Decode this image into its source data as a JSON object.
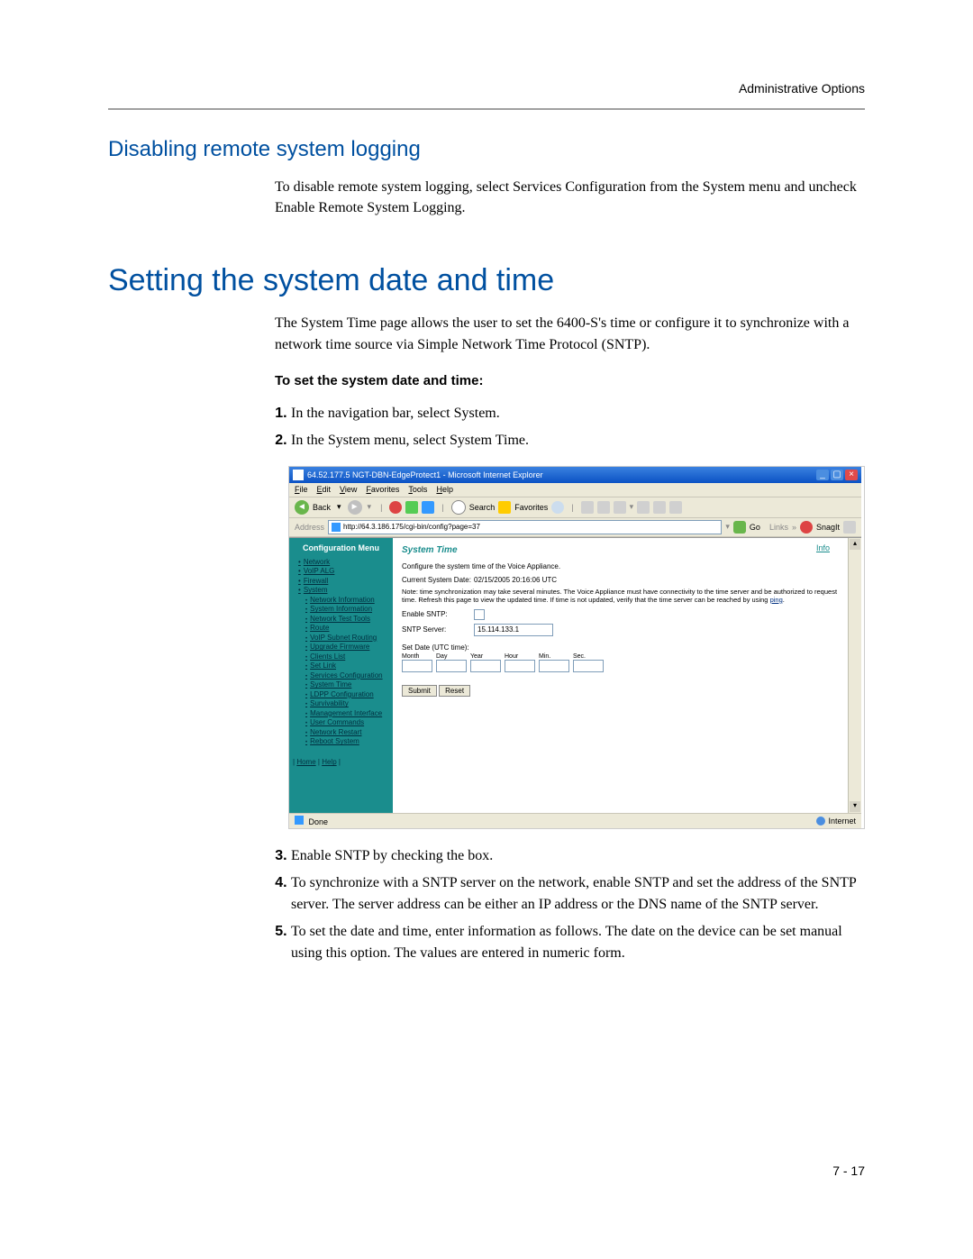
{
  "header": {
    "right": "Administrative Options"
  },
  "section1": {
    "title": "Disabling remote system logging",
    "body": "To disable remote system logging, select Services Configuration from the System menu and uncheck Enable Remote System Logging."
  },
  "section2": {
    "title": "Setting the system date and time",
    "intro": "The System Time page allows the user to set the 6400-S's time or configure it to synchronize with a network time source via Simple Network Time Protocol (SNTP).",
    "sub_heading": "To set the system date and time:",
    "steps_before": [
      "In the navigation bar, select System.",
      "In the System menu, select System Time."
    ],
    "steps_after": [
      "Enable SNTP by checking the box.",
      "To synchronize with a SNTP server on the network, enable SNTP and set the address of the SNTP server. The server address can be either an IP address or the DNS name of the SNTP server.",
      "To set the date and time, enter information as follows. The date on the device can be set manual using this option. The values are entered in numeric form."
    ]
  },
  "page_number": "7 - 17",
  "ie": {
    "title": "64.52.177.5 NGT-DBN-EdgeProtect1 - Microsoft Internet Explorer",
    "menu": [
      "File",
      "Edit",
      "View",
      "Favorites",
      "Tools",
      "Help"
    ],
    "back": "Back",
    "search": "Search",
    "favorites": "Favorites",
    "address_label": "Address",
    "address_value": "http://64.3.186.175/cgi-bin/config?page=37",
    "go": "Go",
    "links": "Links",
    "snagit": "SnagIt",
    "status_done": "Done",
    "status_zone": "Internet"
  },
  "nav": {
    "heading": "Configuration Menu",
    "items": [
      "Network",
      "VoIP ALG",
      "Firewall",
      "System"
    ],
    "sub_items": [
      "Network Information",
      "System Information",
      "Network Test Tools",
      "Route",
      "VoIP Subnet Routing",
      "Upgrade Firmware",
      "Clients List",
      "Set Link",
      "Services Configuration",
      "System Time",
      "LDPP Configuration",
      "Survivability",
      "Management Interface",
      "User Commands",
      "Network Restart",
      "Reboot System"
    ],
    "footer_home": "Home",
    "footer_help": "Help"
  },
  "panel": {
    "title": "System Time",
    "info": "Info",
    "desc": "Configure the system time of the Voice Appliance.",
    "cur_label": "Current System Date:",
    "cur_value": "02/15/2005 20:16:06 UTC",
    "note": "Note: time synchronization may take several minutes. The Voice Appliance must have connectivity to the time server and be authorized to request time. Refresh this page to view the updated time. If time is not updated, verify that the time server can be reached by using ",
    "note_ping": "ping",
    "enable_sntp": "Enable SNTP:",
    "sntp_server": "SNTP Server:",
    "sntp_value": "15.114.133.1",
    "set_date": "Set Date (UTC time):",
    "cols": [
      "Month",
      "Day",
      "Year",
      "Hour",
      "Min.",
      "Sec."
    ],
    "submit": "Submit",
    "reset": "Reset"
  }
}
